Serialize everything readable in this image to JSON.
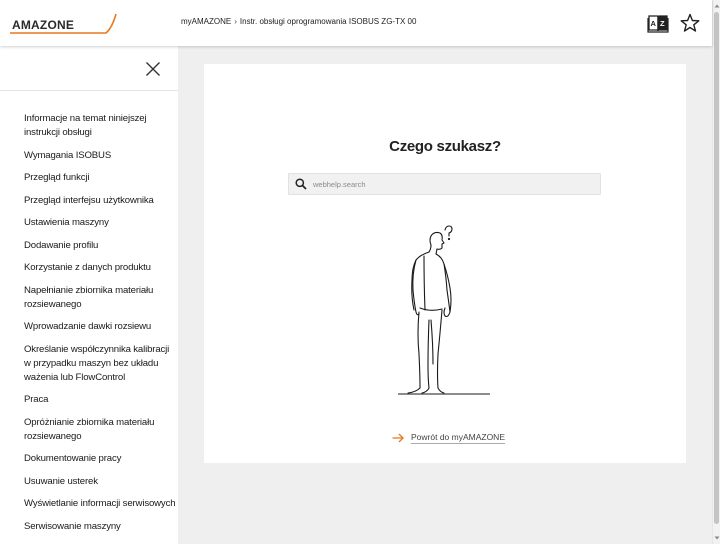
{
  "header": {
    "logo_text": "AMAZONE",
    "breadcrumb": {
      "root": "myAMAZONE",
      "separator": "›",
      "current": "Instr. obsługi oprogramowania ISOBUS ZG-TX 00"
    },
    "icons": [
      "language-switch-icon",
      "favorite-star-icon"
    ]
  },
  "sidebar": {
    "items": [
      {
        "label": "Informacje na temat niniejszej instrukcji obsługi"
      },
      {
        "label": "Wymagania ISOBUS"
      },
      {
        "label": "Przegląd funkcji"
      },
      {
        "label": "Przegląd interfejsu użytkownika"
      },
      {
        "label": "Ustawienia maszyny"
      },
      {
        "label": "Dodawanie profilu"
      },
      {
        "label": "Korzystanie z danych produktu"
      },
      {
        "label": "Napełnianie zbiornika materiału rozsiewanego"
      },
      {
        "label": "Wprowadzanie dawki rozsiewu"
      },
      {
        "label": "Określanie współczynnika kalibracji w przypadku maszyn bez układu ważenia lub FlowControl"
      },
      {
        "label": "Praca"
      },
      {
        "label": "Opróżnianie zbiornika materiału rozsiewanego"
      },
      {
        "label": "Dokumentowanie pracy"
      },
      {
        "label": "Usuwanie usterek"
      },
      {
        "label": "Wyświetlanie informacji serwisowych"
      },
      {
        "label": "Serwisowanie maszyny"
      }
    ]
  },
  "main": {
    "title": "Czego szukasz?",
    "search": {
      "placeholder": "webhelp.search",
      "value": ""
    },
    "back_link": "Powrót do myAMAZONE"
  },
  "colors": {
    "brand_orange": "#e8781e",
    "text_dark": "#222222",
    "page_background": "#efefef",
    "card_background": "#ffffff",
    "search_background": "#f1f1f1"
  }
}
